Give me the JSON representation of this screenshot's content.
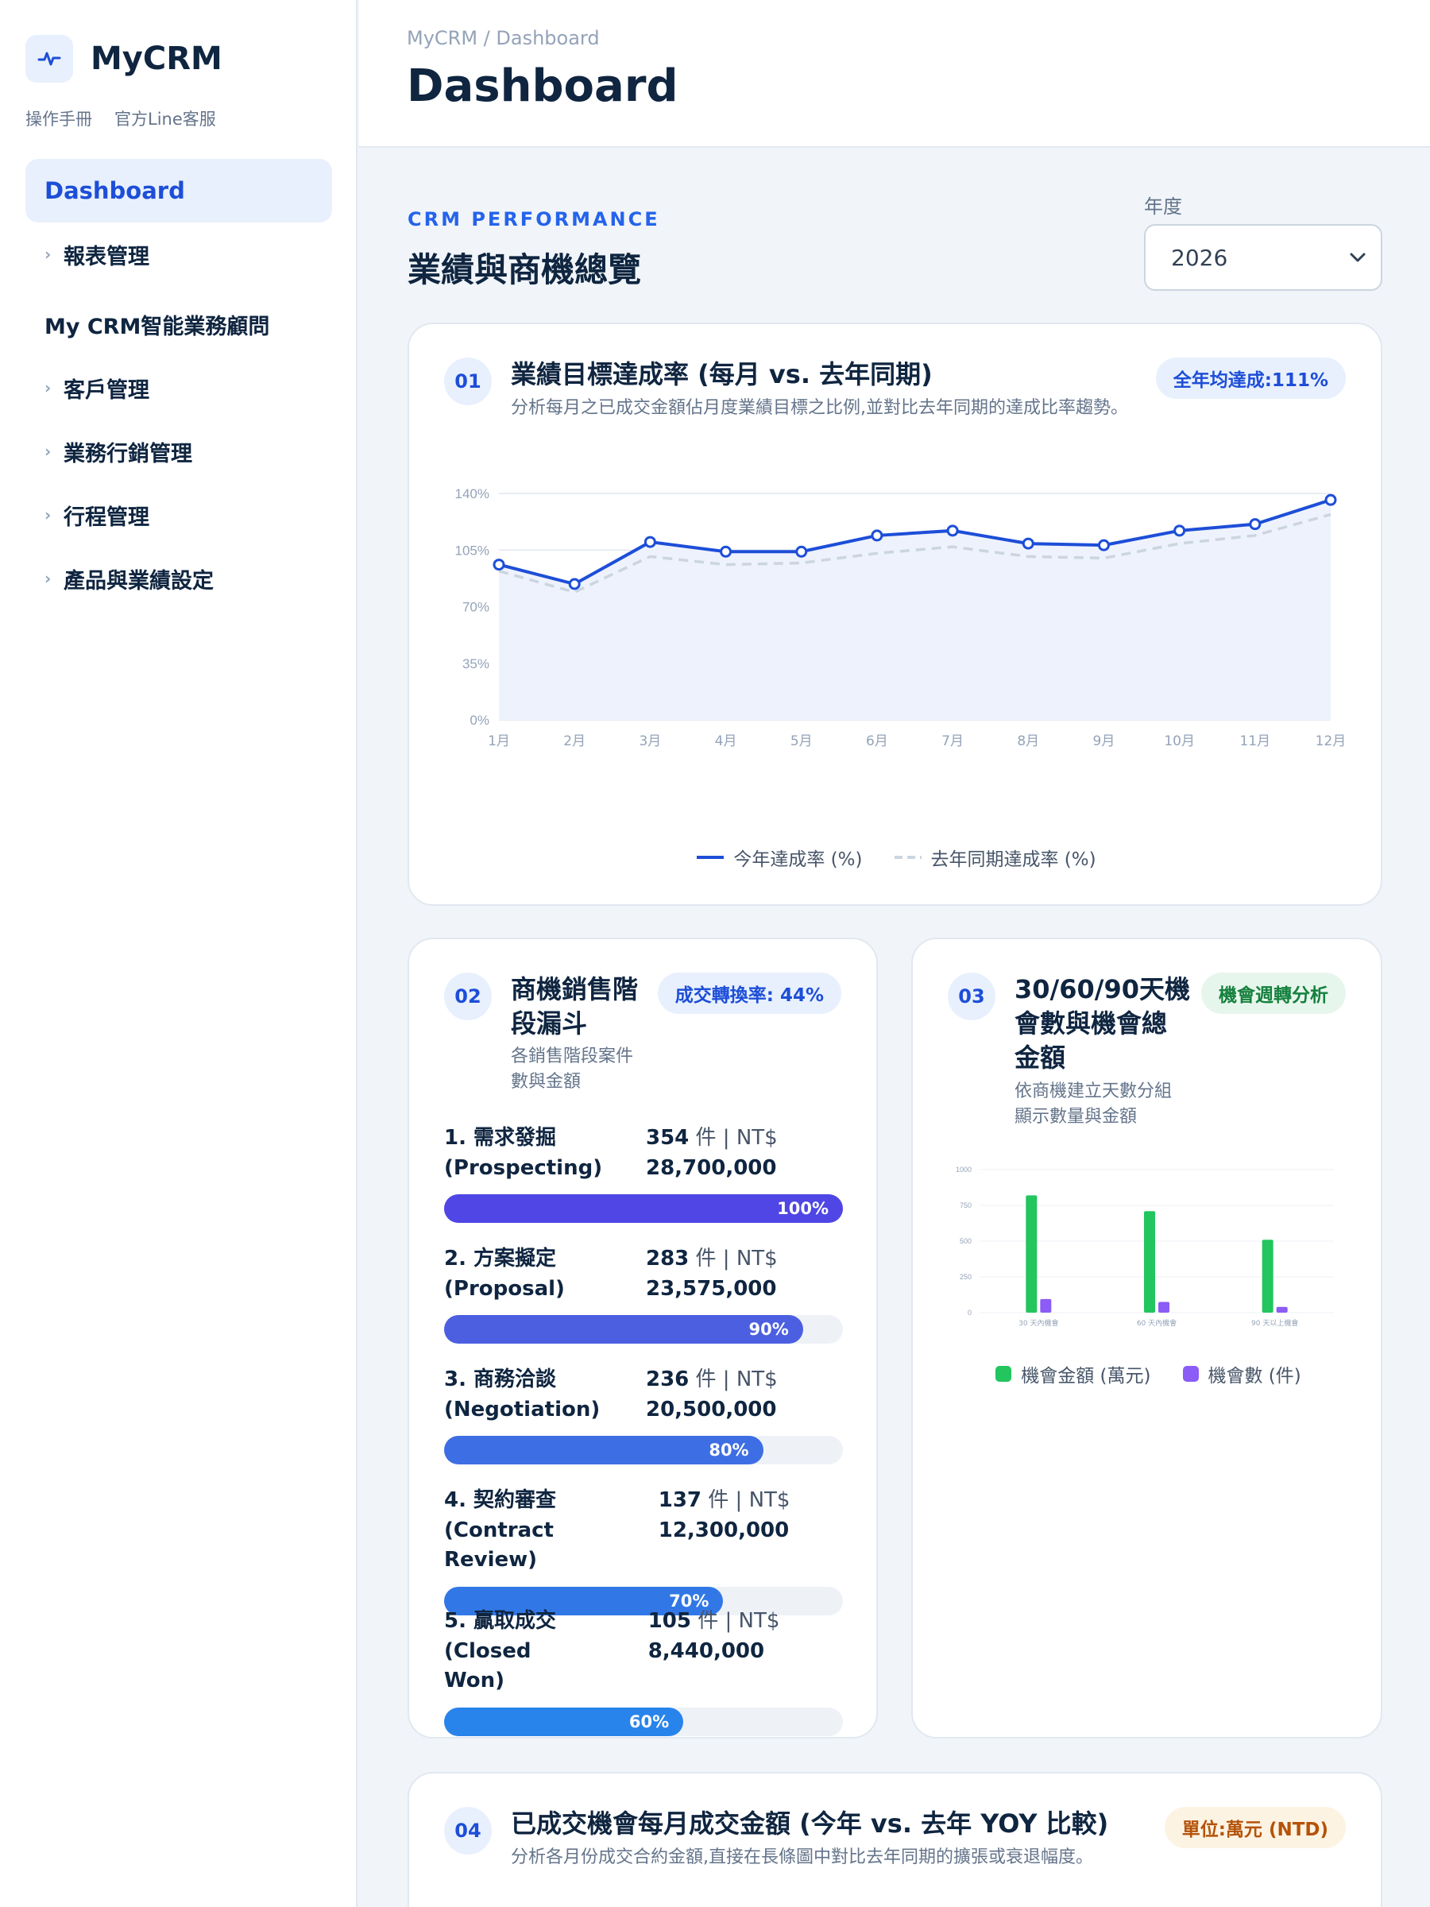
{
  "app": {
    "name": "MyCRM",
    "links": [
      "操作手冊",
      "官方Line客服"
    ]
  },
  "nav": {
    "active": "Dashboard",
    "items_top": [
      "報表管理"
    ],
    "section": "My CRM智能業務顧問",
    "items": [
      "客戶管理",
      "業務行銷管理",
      "行程管理",
      "產品與業績設定"
    ]
  },
  "header": {
    "breadcrumb": "MyCRM / Dashboard",
    "title": "Dashboard"
  },
  "overview": {
    "kicker": "CRM PERFORMANCE",
    "title": "業績與商機總覽",
    "year_label": "年度",
    "year_value": "2026"
  },
  "card1": {
    "num": "01",
    "title": "業績目標達成率 (每月 vs. 去年同期)",
    "subtitle": "分析每月之已成交金額佔月度業績目標之比例,並對比去年同期的達成比率趨勢。",
    "badge": "全年均達成:111%",
    "legend_current": "今年達成率 (%)",
    "legend_last": "去年同期達成率 (%)"
  },
  "card2": {
    "num": "02",
    "title": "商機銷售階段漏斗",
    "subtitle": "各銷售階段案件數與金額",
    "badge": "成交轉換率: 44%",
    "stages": [
      {
        "name_line1": "1. 需求發掘",
        "name_line2": "(Prospecting)",
        "count": "354",
        "count_unit": " 件 | NT$",
        "amount": "28,700,000",
        "pct_label": "100%",
        "pct": 100,
        "color": "#4f46e5"
      },
      {
        "name_line1": "2. 方案擬定",
        "name_line2": "(Proposal)",
        "count": "283",
        "count_unit": " 件 | NT$",
        "amount": "23,575,000",
        "pct_label": "90%",
        "pct": 90,
        "color": "#4b5fe0"
      },
      {
        "name_line1": "3. 商務洽談",
        "name_line2": "(Negotiation)",
        "count": "236",
        "count_unit": " 件 | NT$",
        "amount": "20,500,000",
        "pct_label": "80%",
        "pct": 80,
        "color": "#3e6ee3"
      },
      {
        "name_line1": "4. 契約審查 (Contract",
        "name_line2": "Review)",
        "count": "137",
        "count_unit": " 件 | NT$",
        "amount": "12,300,000",
        "pct_label": "70%",
        "pct": 70,
        "color": "#3178e6"
      },
      {
        "name_line1": "5. 贏取成交 (Closed",
        "name_line2": "Won)",
        "count": "105",
        "count_unit": " 件 | NT$",
        "amount": "8,440,000",
        "pct_label": "60%",
        "pct": 60,
        "color": "#2884ea"
      }
    ]
  },
  "card3": {
    "num": "03",
    "title_lines": [
      "30/60/90天機",
      "會數與機會總",
      "金額"
    ],
    "subtitle_lines": [
      "依商機建立天數分組",
      "顯示數量與金額"
    ],
    "badge": "機會週轉分析"
  },
  "card4": {
    "num": "04",
    "title": "已成交機會每月成交金額 (今年 vs. 去年 YOY 比較)",
    "subtitle": "分析各月份成交合約金額,直接在長條圖中對比去年同期的擴張或衰退幅度。",
    "badge": "單位:萬元 (NTD)"
  },
  "chart_data": [
    {
      "type": "line",
      "x": [
        "1月",
        "2月",
        "3月",
        "4月",
        "5月",
        "6月",
        "7月",
        "8月",
        "9月",
        "10月",
        "11月",
        "12月"
      ],
      "y_ticks": [
        "0%",
        "35%",
        "70%",
        "105%",
        "140%"
      ],
      "ylim": [
        0,
        140
      ],
      "grid": true,
      "legend": "bottom",
      "series": [
        {
          "name": "今年達成率 (%)",
          "values": [
            96,
            84,
            110,
            104,
            104,
            114,
            117,
            109,
            108,
            117,
            121,
            136
          ],
          "color": "#1d4ed8",
          "style": "solid",
          "fill": true
        },
        {
          "name": "去年同期達成率 (%)",
          "values": [
            92,
            79,
            101,
            96,
            97,
            103,
            107,
            101,
            100,
            109,
            114,
            127
          ],
          "color": "#cbd5e1",
          "style": "dashed"
        }
      ]
    },
    {
      "type": "bar",
      "categories": [
        "30 天內機會",
        "60 天內機會",
        "90 天以上機會"
      ],
      "y_ticks": [
        "0",
        "250",
        "500",
        "750",
        "1000"
      ],
      "ylim": [
        0,
        1000
      ],
      "grid": true,
      "legend": "bottom",
      "series": [
        {
          "name": "機會金額 (萬元)",
          "values": [
            820,
            710,
            510
          ],
          "color": "#22c55e"
        },
        {
          "name": "機會數 (件)",
          "values": [
            95,
            75,
            40
          ],
          "color": "#8b5cf6"
        }
      ]
    }
  ]
}
